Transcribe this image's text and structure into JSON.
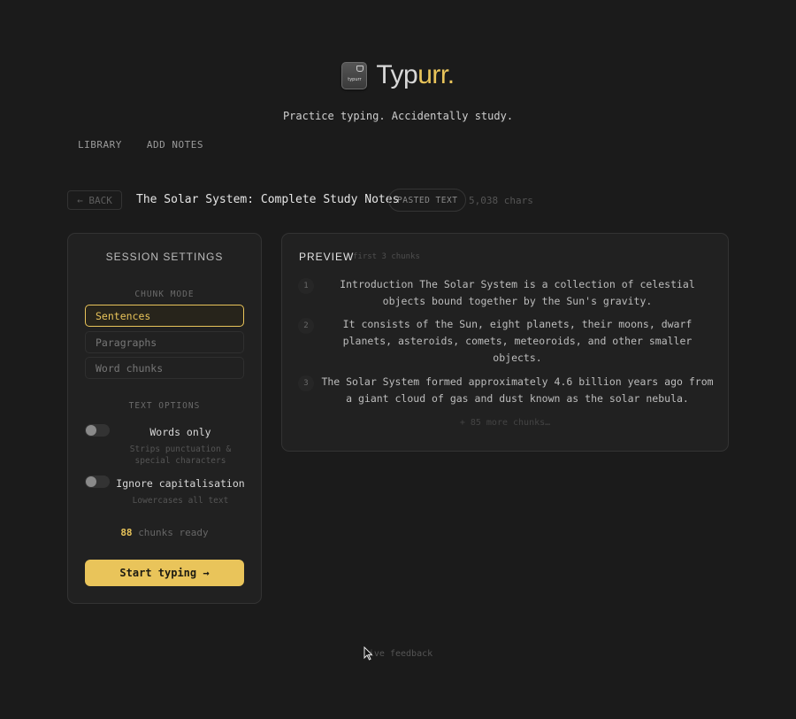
{
  "brand": {
    "name": "Typ",
    "accent": "urr.",
    "logo_text": "typurr"
  },
  "tagline": "Practice typing. Accidentally study.",
  "nav": [
    {
      "label": "LIBRARY"
    },
    {
      "label": "ADD NOTES"
    }
  ],
  "doc": {
    "back_label": "← BACK",
    "title": "The Solar System: Complete Study Notes",
    "source_badge": "PASTED TEXT",
    "char_count": "5,038 chars"
  },
  "settings": {
    "title": "SESSION SETTINGS",
    "chunk_mode_label": "CHUNK MODE",
    "modes": [
      {
        "label": "Sentences",
        "active": true
      },
      {
        "label": "Paragraphs",
        "active": false
      },
      {
        "label": "Word chunks",
        "active": false
      }
    ],
    "text_options_label": "TEXT OPTIONS",
    "options": [
      {
        "label": "Words only",
        "hint": "Strips punctuation & special characters",
        "enabled": false
      },
      {
        "label": "Ignore capitalisation",
        "hint": "Lowercases all text",
        "enabled": false
      }
    ],
    "chunks_count": "88",
    "chunks_ready_label": "chunks ready",
    "start_label": "Start typing →"
  },
  "preview": {
    "title": "PREVIEW",
    "subtitle": "first 3 chunks",
    "chunks": [
      {
        "num": "1",
        "text": "Introduction The Solar System is a collection of celestial objects bound together by the Sun's gravity."
      },
      {
        "num": "2",
        "text": "It consists of the Sun, eight planets, their moons, dwarf planets, asteroids, comets, meteoroids, and other smaller objects."
      },
      {
        "num": "3",
        "text": "The Solar System formed approximately 4.6 billion years ago from a giant cloud of gas and dust known as the solar nebula."
      }
    ],
    "more": "+ 85 more chunks…"
  },
  "footer": {
    "feedback": "Give feedback"
  },
  "colors": {
    "accent": "#e9c45a",
    "background": "#1b1b1b",
    "panel": "#212121"
  }
}
